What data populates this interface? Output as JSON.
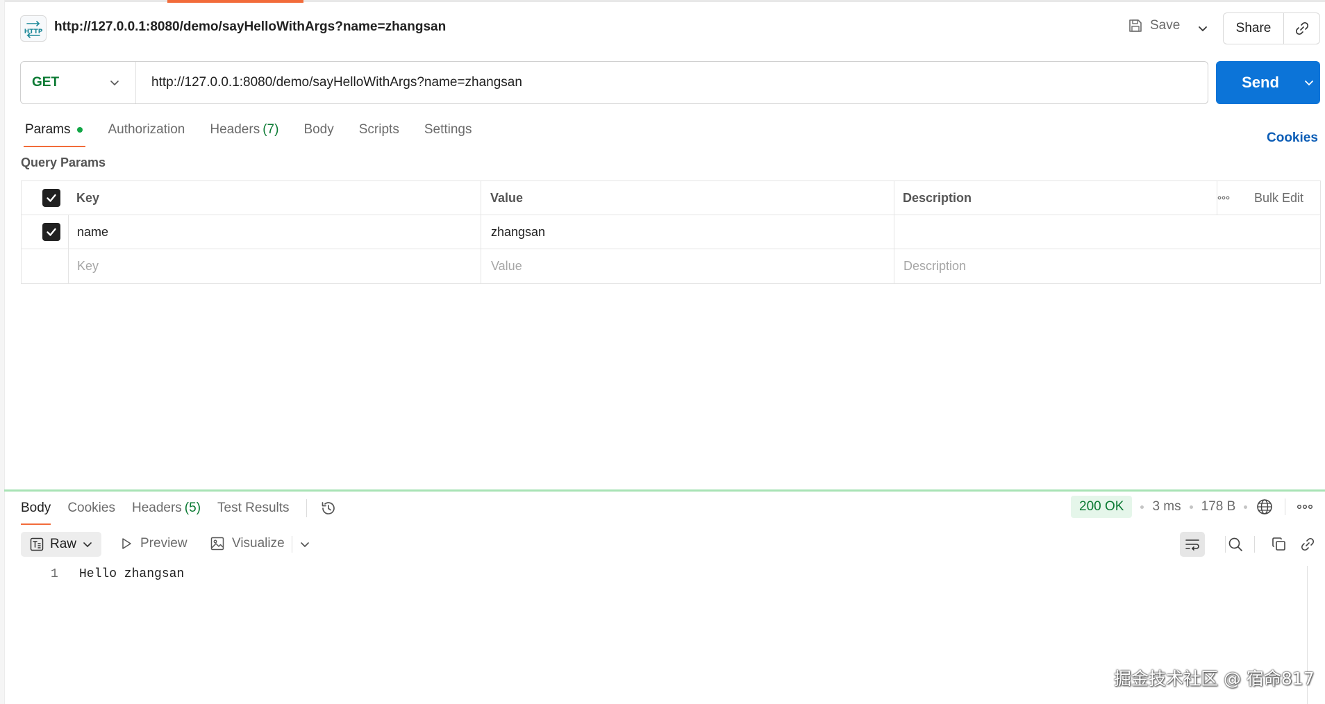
{
  "header": {
    "title": "http://127.0.0.1:8080/demo/sayHelloWithArgs?name=zhangsan",
    "http_badge": "HTTP",
    "save_label": "Save",
    "share_label": "Share"
  },
  "request": {
    "method": "GET",
    "url": "http://127.0.0.1:8080/demo/sayHelloWithArgs?name=zhangsan",
    "send_label": "Send"
  },
  "request_tabs": {
    "params": "Params",
    "authorization": "Authorization",
    "headers": "Headers",
    "headers_count": "(7)",
    "body": "Body",
    "scripts": "Scripts",
    "settings": "Settings",
    "cookies": "Cookies"
  },
  "query_params": {
    "label": "Query Params",
    "columns": {
      "key": "Key",
      "value": "Value",
      "description": "Description",
      "bulk_edit": "Bulk Edit"
    },
    "rows": [
      {
        "checked": true,
        "key": "name",
        "value": "zhangsan",
        "description": ""
      }
    ],
    "placeholders": {
      "key": "Key",
      "value": "Value",
      "description": "Description"
    }
  },
  "response_tabs": {
    "body": "Body",
    "cookies": "Cookies",
    "headers": "Headers",
    "headers_count": "(5)",
    "test_results": "Test Results"
  },
  "response_meta": {
    "status": "200 OK",
    "time": "3 ms",
    "size": "178 B"
  },
  "response_toolbar": {
    "raw": "Raw",
    "preview": "Preview",
    "visualize": "Visualize"
  },
  "response_body": {
    "lines": [
      {
        "number": "1",
        "text": "Hello zhangsan"
      }
    ]
  },
  "watermark": "掘金技术社区 @ 宿命817",
  "colors": {
    "accent_orange": "#f26b3a",
    "send_blue": "#0c74d8",
    "method_green": "#0b7a33",
    "status_green_bg": "#e5f6ea"
  }
}
